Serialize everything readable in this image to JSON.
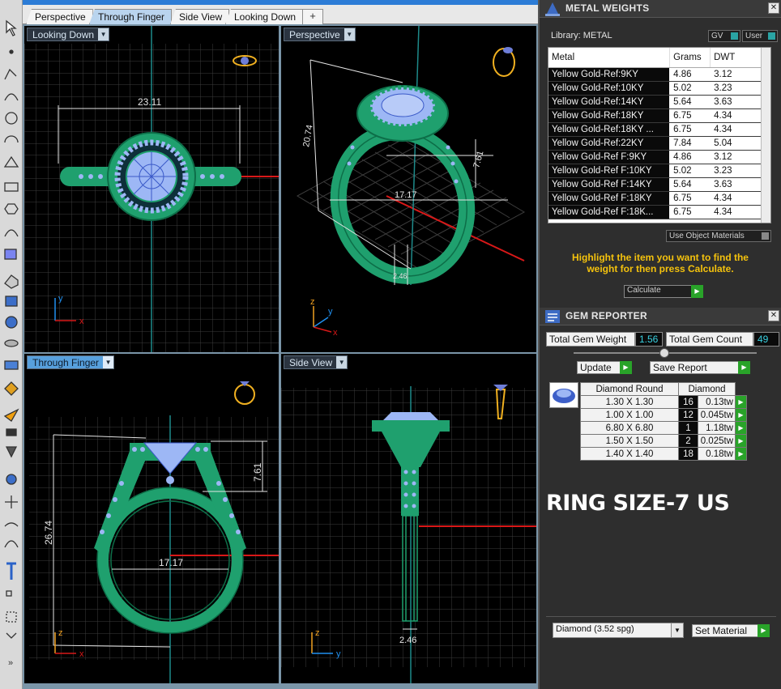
{
  "tabs": [
    {
      "label": "Perspective",
      "active": false
    },
    {
      "label": "Through Finger",
      "active": true
    },
    {
      "label": "Side View",
      "active": false
    },
    {
      "label": "Looking Down",
      "active": false
    }
  ],
  "tab_add_icon": "plus-icon",
  "viewports": {
    "top_left": {
      "label": "Looking Down",
      "dim_width": "23.11",
      "axis_y": "y",
      "axis_x": "x"
    },
    "top_right": {
      "label": "Perspective",
      "dim_height": "20.74",
      "dim_inner": "17.17",
      "dim_top": "7.61",
      "dim_band": "2.46",
      "axis_z": "z",
      "axis_y": "y",
      "axis_x": "x"
    },
    "bottom_left": {
      "label": "Through Finger",
      "dim_height": "26.74",
      "dim_top": "7.61",
      "dim_inner": "17.17",
      "axis_z": "z",
      "axis_x": "x"
    },
    "bottom_right": {
      "label": "Side View",
      "dim_band": "2.46",
      "axis_z": "z",
      "axis_y": "y"
    }
  },
  "metal_weights": {
    "title": "METAL WEIGHTS",
    "library_label": "Library: METAL",
    "gv_label": "GV",
    "user_label": "User",
    "columns": [
      "Metal",
      "Grams",
      "DWT"
    ],
    "rows": [
      [
        "Yellow Gold-Ref:9KY",
        "4.86",
        "3.12"
      ],
      [
        "Yellow Gold-Ref:10KY",
        "5.02",
        "3.23"
      ],
      [
        "Yellow Gold-Ref:14KY",
        "5.64",
        "3.63"
      ],
      [
        "Yellow Gold-Ref:18KY",
        "6.75",
        "4.34"
      ],
      [
        "Yellow Gold-Ref:18KY ...",
        "6.75",
        "4.34"
      ],
      [
        "Yellow Gold-Ref:22KY",
        "7.84",
        "5.04"
      ],
      [
        "Yellow Gold-Ref F:9KY",
        "4.86",
        "3.12"
      ],
      [
        "Yellow Gold-Ref F:10KY",
        "5.02",
        "3.23"
      ],
      [
        "Yellow Gold-Ref F:14KY",
        "5.64",
        "3.63"
      ],
      [
        "Yellow Gold-Ref F:18KY",
        "6.75",
        "4.34"
      ],
      [
        "Yellow Gold-Ref F:18K...",
        "6.75",
        "4.34"
      ]
    ],
    "use_object_materials": "Use Object Materials",
    "message": "Highlight the item you want to find the weight for then press Calculate.",
    "calculate_label": "Calculate"
  },
  "gem_reporter": {
    "title": "GEM REPORTER",
    "total_weight_label": "Total Gem Weight",
    "total_weight_value": "1.56",
    "total_count_label": "Total Gem Count",
    "total_count_value": "49",
    "update_label": "Update",
    "save_report_label": "Save Report",
    "gem_shape": "Diamond Round",
    "gem_material": "Diamond",
    "rows": [
      {
        "size": "1.30 X 1.30",
        "count": "16",
        "weight": "0.13tw"
      },
      {
        "size": "1.00 X 1.00",
        "count": "12",
        "weight": "0.045tw"
      },
      {
        "size": "6.80 X 6.80",
        "count": "1",
        "weight": "1.18tw"
      },
      {
        "size": "1.50 X 1.50",
        "count": "2",
        "weight": "0.025tw"
      },
      {
        "size": "1.40 X 1.40",
        "count": "18",
        "weight": "0.18tw"
      }
    ],
    "note": "RING SIZE-7 US",
    "material_select": "Diamond     (3.52 spg)",
    "set_material_label": "Set Material"
  },
  "colors": {
    "ring_green": "#1fa06e",
    "gem_blue": "#9db7f5",
    "accent_blue": "#2c7cd6",
    "grid": "#3c3c3c",
    "dim_line": "#e6e6e6",
    "axis_red": "#d81818",
    "highlight_yellow": "#f4c20d",
    "thumb_gold": "#f0b020"
  }
}
